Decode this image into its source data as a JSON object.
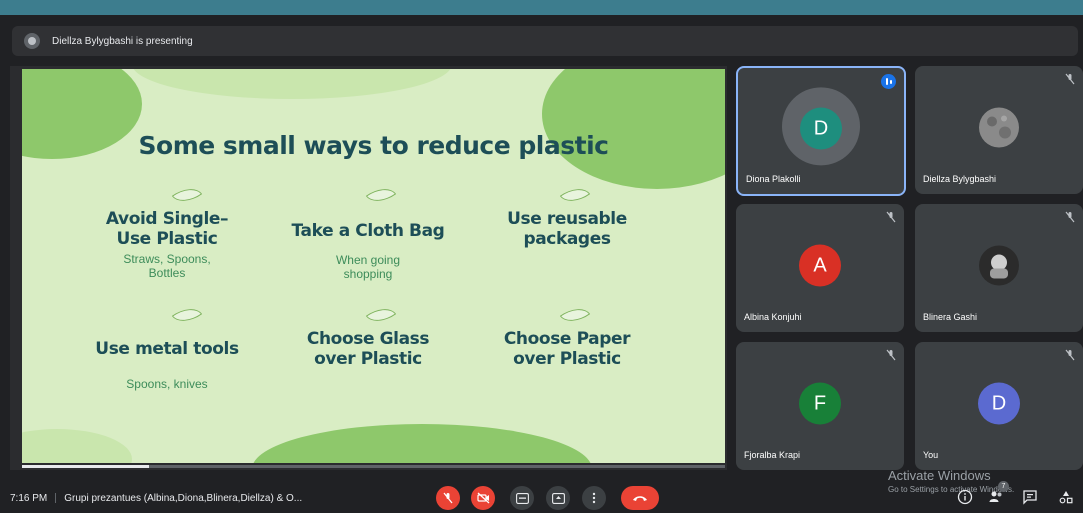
{
  "banner": {
    "text": "Diellza Bylygbashi is presenting"
  },
  "slide": {
    "title": "Some small ways to reduce plastic",
    "items": [
      {
        "title_line1": "Avoid Single–",
        "title_line2": "Use Plastic",
        "sub_line1": "Straws, Spoons,",
        "sub_line2": "Bottles"
      },
      {
        "title_line1": "Take a Cloth Bag",
        "title_line2": "",
        "sub_line1": "When going",
        "sub_line2": "shopping"
      },
      {
        "title_line1": "Use reusable",
        "title_line2": "packages",
        "sub_line1": "",
        "sub_line2": ""
      },
      {
        "title_line1": "Use metal tools",
        "title_line2": "",
        "sub_line1": "Spoons, knives",
        "sub_line2": ""
      },
      {
        "title_line1": "Choose Glass",
        "title_line2": "over Plastic",
        "sub_line1": "",
        "sub_line2": ""
      },
      {
        "title_line1": "Choose Paper",
        "title_line2": "over Plastic",
        "sub_line1": "",
        "sub_line2": ""
      }
    ],
    "colors": {
      "background": "#d9edc4",
      "blob": "#8ec86b",
      "title": "#1d4e57",
      "subtitle": "#3d8c5a"
    }
  },
  "participants": [
    {
      "name": "Diona Plakolli",
      "initial": "D",
      "color": "#1e8e7e",
      "speaking": true
    },
    {
      "name": "Diellza Bylygbashi",
      "initial": "",
      "color": "#888888",
      "muted": true
    },
    {
      "name": "Albina Konjuhi",
      "initial": "A",
      "color": "#d93025",
      "muted": true
    },
    {
      "name": "Blinera Gashi",
      "initial": "",
      "color": "#777777",
      "muted": true
    },
    {
      "name": "Fjoralba Krapi",
      "initial": "F",
      "color": "#188038",
      "muted": true
    },
    {
      "name": "You",
      "initial": "D",
      "color": "#5b6ad0",
      "muted": true
    }
  ],
  "bottom": {
    "time": "7:16 PM",
    "meeting_name": "Grupi prezantues (Albina,Diona,Blinera,Diellza) & O...",
    "watermark_title": "Activate Windows",
    "watermark_sub": "Go to Settings to activate Windows.",
    "people_count": "7"
  }
}
